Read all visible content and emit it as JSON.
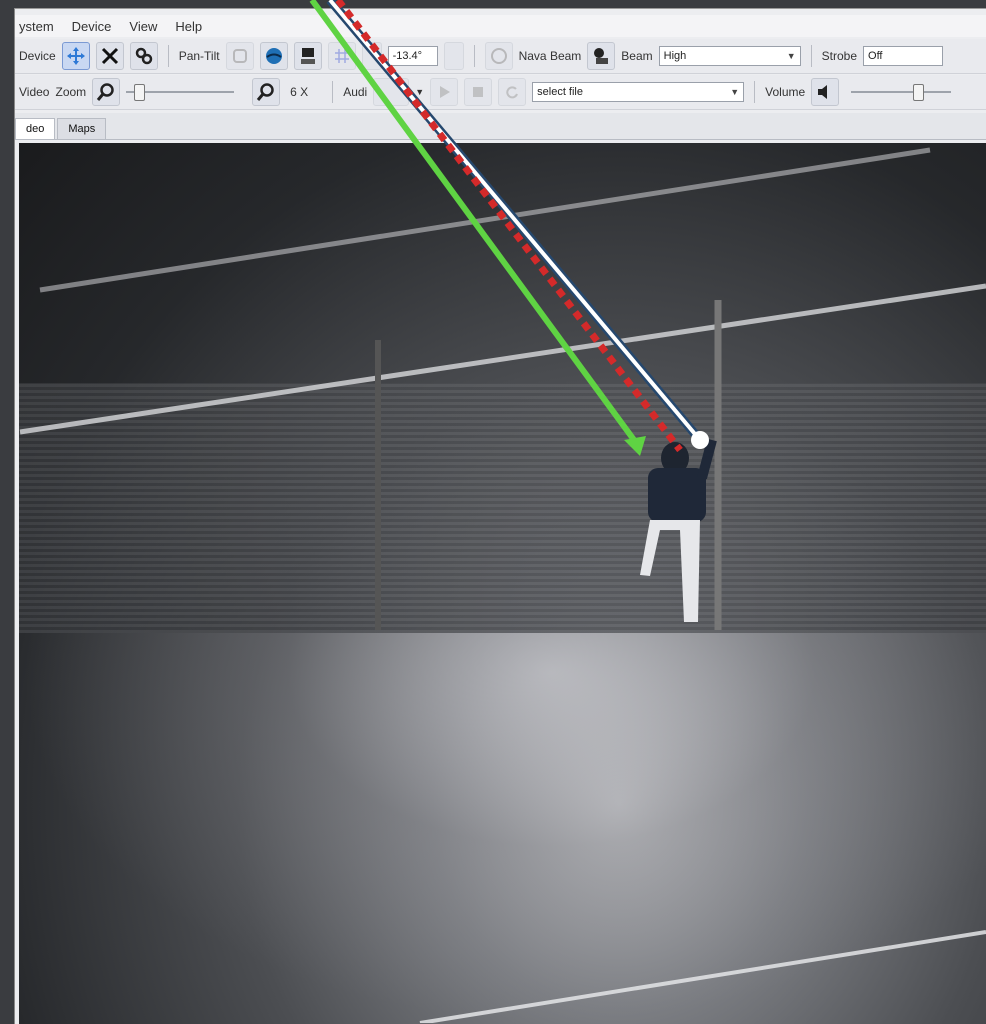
{
  "menu": [
    "ystem",
    "Device",
    "View",
    "Help"
  ],
  "toolbar1": {
    "device_label": "Device",
    "pantilt_label": "Pan-Tilt",
    "tilt_value": "-13.4°",
    "nav_beam_label": "Nava Beam",
    "beam_label": "Beam",
    "beam_value": "High",
    "strobe_label": "Strobe",
    "strobe_value": "Off"
  },
  "toolbar2": {
    "video_label": "Video",
    "zoom_label": "Zoom",
    "zoom_value": "6 X",
    "audio_label": "Audi",
    "file_value": "select file",
    "volume_label": "Volume",
    "zoom_level": 0.08,
    "volume_level": 0.7
  },
  "tabs": [
    "deo",
    "Maps"
  ],
  "overlay_colors": {
    "green": "#5fd343",
    "white": "#ffffff",
    "red": "#d42a2a",
    "blue_edge": "#26486e"
  }
}
